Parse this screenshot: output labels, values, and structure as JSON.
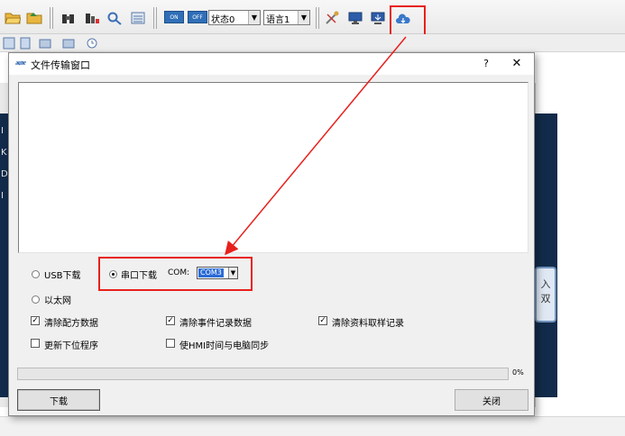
{
  "toolbar": {
    "on_label": "ON",
    "off_label": "OFF",
    "state_select": "状态0",
    "language_select": "语言1",
    "icons": [
      "folder-open-icon",
      "folder-icon",
      "binoculars-icon",
      "find-icon",
      "magnifier-icon",
      "list-icon",
      "on-toggle-icon",
      "off-toggle-icon",
      "tools-icon",
      "monitor-icon",
      "monitor-download-icon",
      "cloud-download-icon"
    ]
  },
  "background": {
    "left_letters": [
      "I",
      "K",
      "D",
      "I"
    ],
    "side_button_text": "入\n双"
  },
  "dialog": {
    "title": "文件传输窗口",
    "help": "?",
    "close": "✕",
    "options": {
      "usb": "USB下载",
      "serial": "串口下载",
      "com_label": "COM:",
      "com_value": "COM3",
      "ethernet": "以太网",
      "clear_recipe": "清除配方数据",
      "clear_events": "清除事件记录数据",
      "clear_sampling": "清除资料取样记录",
      "update_firmware": "更新下位程序",
      "sync_time": "使HMI时间与电脑同步"
    },
    "progress": {
      "percent_text": "0%",
      "value": 0
    },
    "download_button": "下载",
    "close_button": "关闭"
  },
  "colors": {
    "highlight": "#e8201c",
    "dark_panel": "#122b4a",
    "selection": "#2c6cd6"
  }
}
